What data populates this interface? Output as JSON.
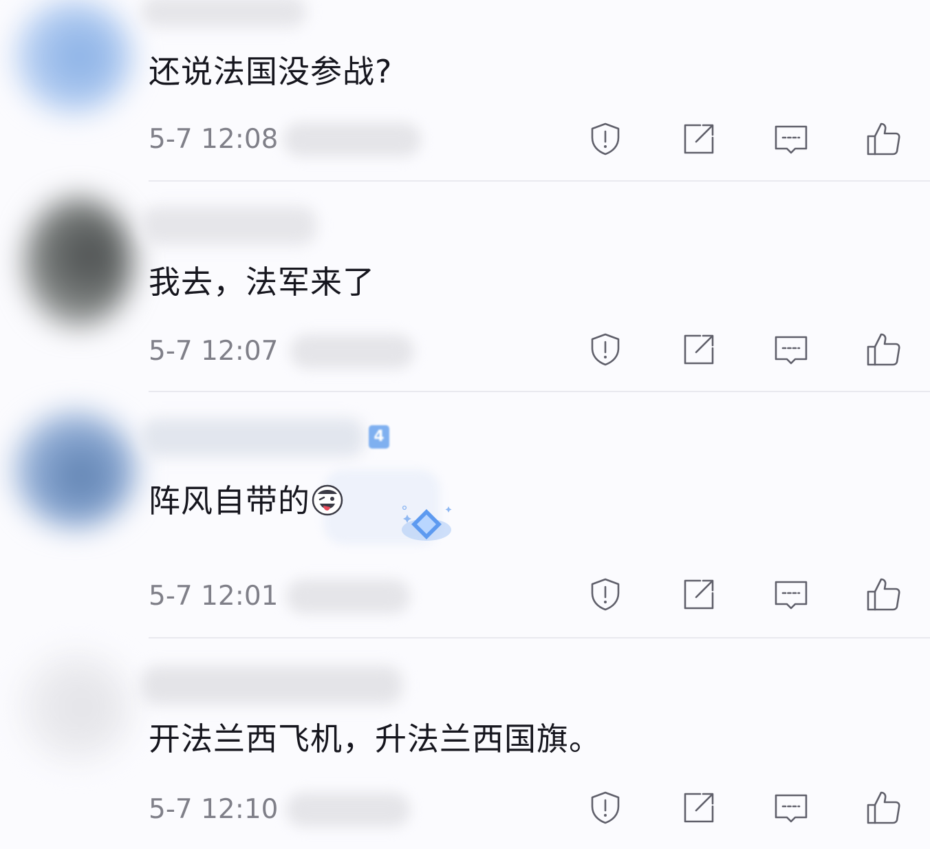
{
  "comments": [
    {
      "text": "还说法国没参战?",
      "timestamp": "5-7 12:08",
      "has_badge": false
    },
    {
      "text": "我去，法军来了",
      "timestamp": "5-7 12:07",
      "has_badge": false
    },
    {
      "text": "阵风自带的",
      "timestamp": "5-7 12:01",
      "has_badge": true,
      "badge_text": "4",
      "emoji": "laughing-tongue-emoji",
      "sticker": "blue-diamond-sticker"
    },
    {
      "text": "开法兰西飞机，升法兰西国旗。",
      "timestamp": "5-7 12:10",
      "has_badge": false
    }
  ],
  "actions": [
    {
      "name": "report",
      "icon": "shield-alert-icon"
    },
    {
      "name": "share",
      "icon": "share-external-icon"
    },
    {
      "name": "reply",
      "icon": "comment-bubble-icon"
    },
    {
      "name": "like",
      "icon": "thumbs-up-icon"
    }
  ],
  "colors": {
    "background": "#fbfbfe",
    "text": "#16161e",
    "meta": "#7f7f88",
    "icon": "#5f5f6a",
    "divider": "#e9e9ef",
    "badge": "#7fb0f0"
  }
}
